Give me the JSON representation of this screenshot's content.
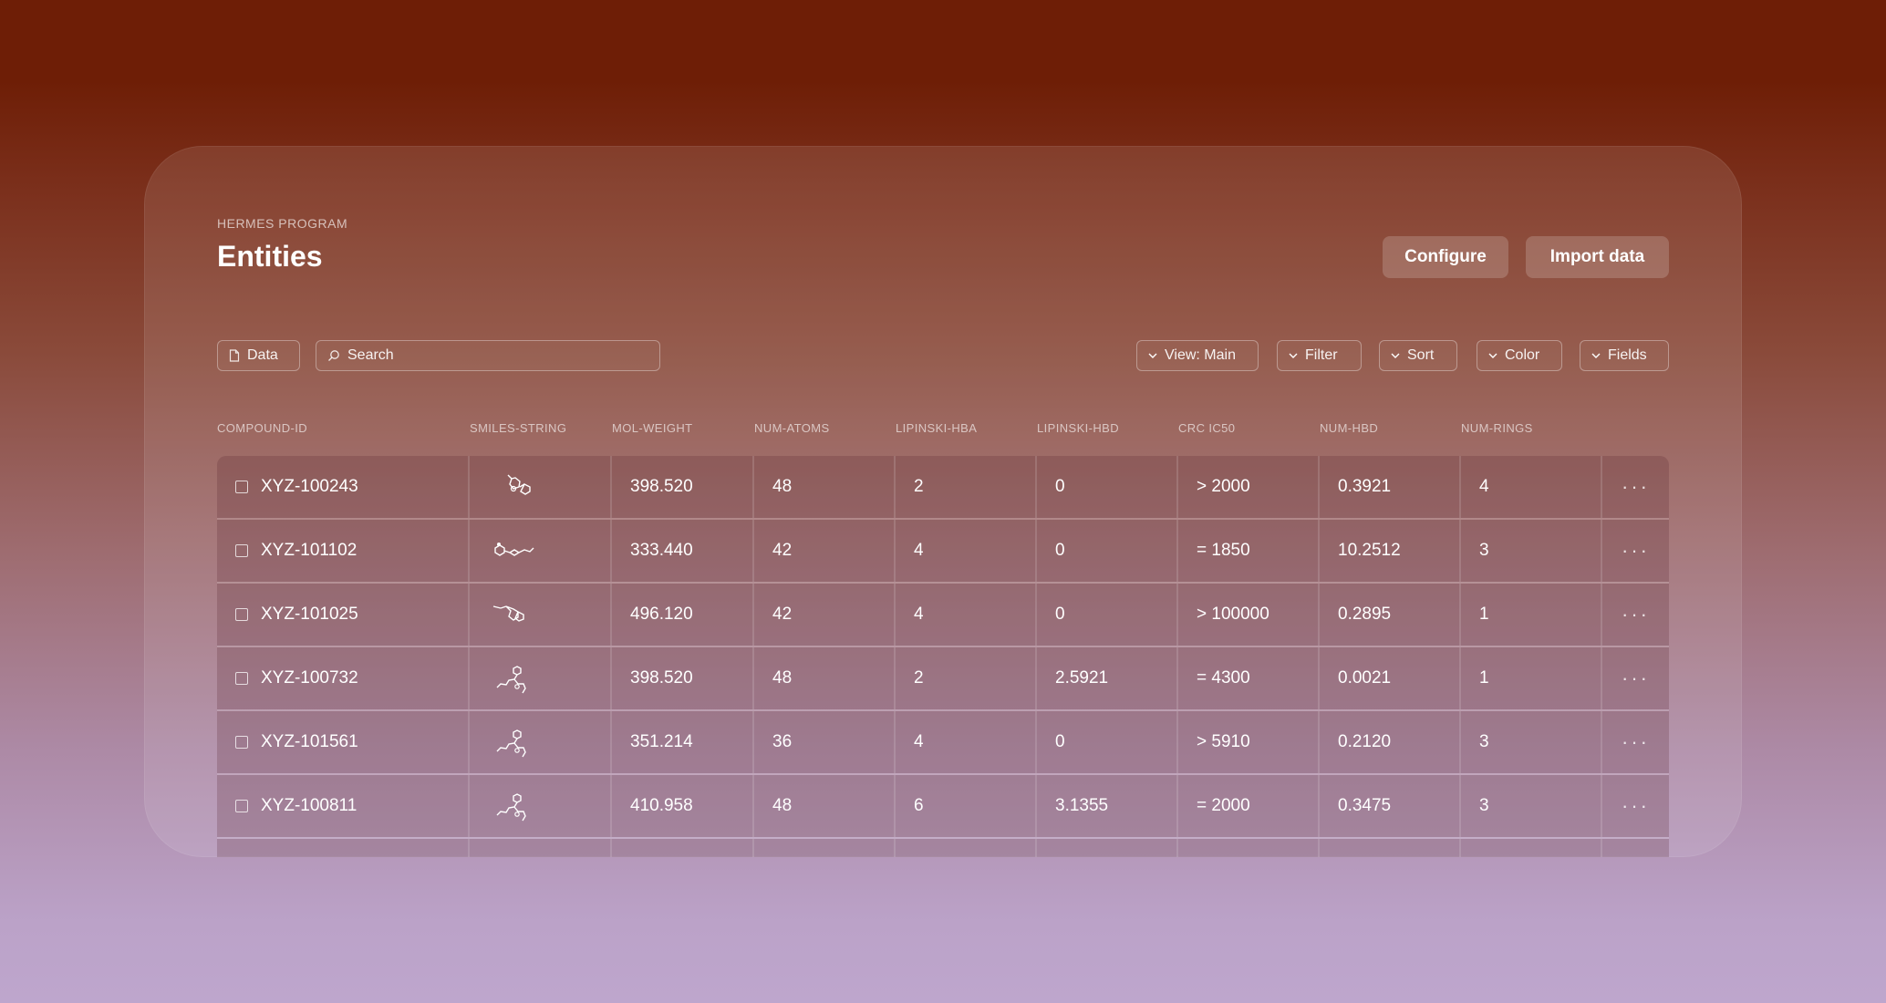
{
  "header": {
    "program": "HERMES PROGRAM",
    "title": "Entities",
    "configure_label": "Configure",
    "import_label": "Import data"
  },
  "toolbar": {
    "data_label": "Data",
    "search_placeholder": "Search",
    "view_label": "View: Main",
    "filter_label": "Filter",
    "sort_label": "Sort",
    "color_label": "Color",
    "fields_label": "Fields"
  },
  "columns": [
    "COMPOUND-ID",
    "SMILES-STRING",
    "MOL-WEIGHT",
    "NUM-ATOMS",
    "LIPINSKI-HBA",
    "LIPINSKI-HBD",
    "CRC IC50",
    "NUM-HBD",
    "NUM-RINGS"
  ],
  "rows": [
    {
      "id": "XYZ-100243",
      "mol_weight": "398.520",
      "num_atoms": "48",
      "hba": "2",
      "hbd": "0",
      "ic50": "> 2000",
      "num_hbd": "0.3921",
      "num_rings": "4"
    },
    {
      "id": "XYZ-101102",
      "mol_weight": "333.440",
      "num_atoms": "42",
      "hba": "4",
      "hbd": "0",
      "ic50": "= 1850",
      "num_hbd": "10.2512",
      "num_rings": "3"
    },
    {
      "id": "XYZ-101025",
      "mol_weight": "496.120",
      "num_atoms": "42",
      "hba": "4",
      "hbd": "0",
      "ic50": "> 100000",
      "num_hbd": "0.2895",
      "num_rings": "1"
    },
    {
      "id": "XYZ-100732",
      "mol_weight": "398.520",
      "num_atoms": "48",
      "hba": "2",
      "hbd": "2.5921",
      "ic50": "= 4300",
      "num_hbd": "0.0021",
      "num_rings": "1"
    },
    {
      "id": "XYZ-101561",
      "mol_weight": "351.214",
      "num_atoms": "36",
      "hba": "4",
      "hbd": "0",
      "ic50": "> 5910",
      "num_hbd": "0.2120",
      "num_rings": "3"
    },
    {
      "id": "XYZ-100811",
      "mol_weight": "410.958",
      "num_atoms": "48",
      "hba": "6",
      "hbd": "3.1355",
      "ic50": "= 2000",
      "num_hbd": "0.3475",
      "num_rings": "3"
    }
  ],
  "icons": {
    "data": "document-icon",
    "search": "search-icon",
    "dropdown": "chevron-down-icon",
    "row_menu": "more-horizontal-icon",
    "structure": "molecule-structure-icon"
  },
  "colors": {
    "background_top": "#6e1e06",
    "background_bottom": "#bea6cd",
    "text": "#ffffff"
  }
}
